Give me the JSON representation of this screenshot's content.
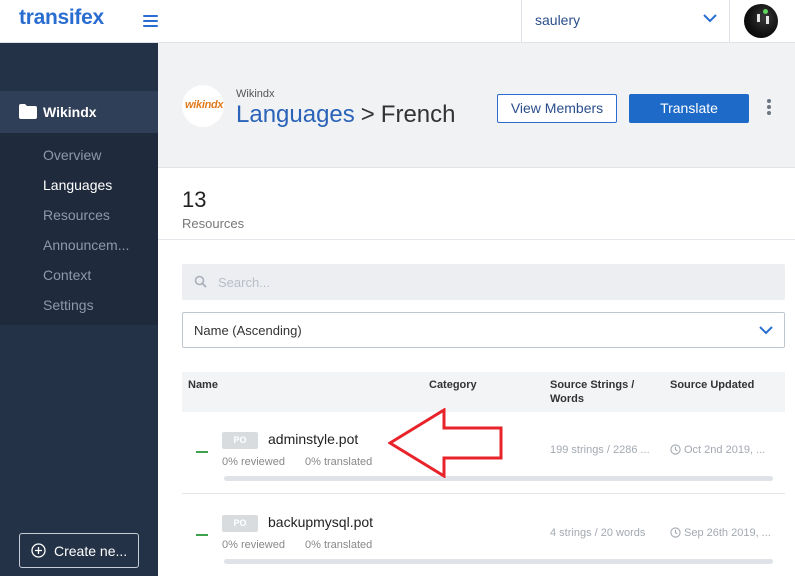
{
  "topbar": {
    "logo": "transifex",
    "org_name": "saulery"
  },
  "sidebar": {
    "project": "Wikindx",
    "items": [
      {
        "label": "Overview",
        "active": false
      },
      {
        "label": "Languages",
        "active": true
      },
      {
        "label": "Resources",
        "active": false
      },
      {
        "label": "Announcem...",
        "active": false
      },
      {
        "label": "Context",
        "active": false
      },
      {
        "label": "Settings",
        "active": false
      }
    ],
    "create_label": "Create ne..."
  },
  "header": {
    "project_logo_text": "wikindx",
    "project_name": "Wikindx",
    "breadcrumb_link": "Languages",
    "breadcrumb_sep": ">",
    "breadcrumb_current": "French",
    "view_members_label": "View Members",
    "translate_label": "Translate"
  },
  "summary": {
    "count": "13",
    "label": "Resources"
  },
  "search": {
    "placeholder": "Search..."
  },
  "sort": {
    "selected": "Name (Ascending)"
  },
  "table": {
    "headers": {
      "name": "Name",
      "category": "Category",
      "strings": "Source Strings / Words",
      "updated": "Source Updated"
    },
    "rows": [
      {
        "badge": "PO",
        "name": "adminstyle.pot",
        "reviewed": "0% reviewed",
        "translated": "0% translated",
        "strings": "199 strings / 2286 ...",
        "updated": "Oct 2nd 2019, ...",
        "progress": 0
      },
      {
        "badge": "PO",
        "name": "backupmysql.pot",
        "reviewed": "0% reviewed",
        "translated": "0% translated",
        "strings": "4 strings / 20 words",
        "updated": "Sep 26th 2019, ...",
        "progress": 0
      }
    ]
  },
  "colors": {
    "brand": "#2a6dd1",
    "sidebar": "#243247",
    "annotation_arrow": "#e8232a"
  }
}
